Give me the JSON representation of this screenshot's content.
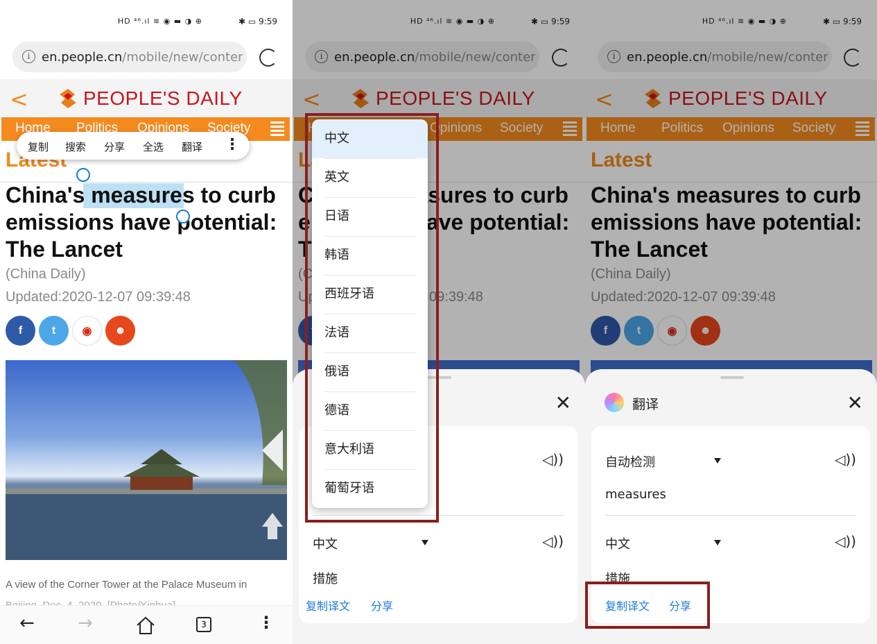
{
  "status": {
    "icons": "HD ⁴⁶.ıl ≋ ◉ ▬ ◑ ⊕",
    "right": "✱ ▭ 9:59"
  },
  "browser": {
    "url_domain": "en.people.cn",
    "url_path": "/mobile/new/content.",
    "tab_count": "3"
  },
  "site": {
    "brand": "PEOPLE'S DAILY",
    "nav": [
      "Home",
      "Politics",
      "Opinions",
      "Society"
    ],
    "section": "Latest",
    "headline_pre": "China's ",
    "headline_sel": "measures",
    "headline_post": " to curb emissions have potential: The Lancet",
    "headline_full": "China's measures to curb emissions have potential: The Lancet",
    "source": "(China Daily)",
    "updated": "Updated:2020-12-07 09:39:48",
    "caption": "A view of the Corner Tower at the Palace Museum in",
    "caption2": "Beijing, Dec. 4, 2020. [Photo/Xinhua]"
  },
  "context_menu": [
    "复制",
    "搜索",
    "分享",
    "全选",
    "翻译"
  ],
  "translate": {
    "title": "翻译",
    "source_lang": "自动检测",
    "source_text": "measures",
    "target_lang": "中文",
    "target_text": "措施",
    "copy_label": "复制译文",
    "share_label": "分享"
  },
  "languages": [
    "中文",
    "英文",
    "日语",
    "韩语",
    "西班牙语",
    "法语",
    "俄语",
    "德语",
    "意大利语",
    "葡萄牙语"
  ],
  "colors": {
    "orange": "#f58b1f",
    "brand_red": "#c8161e",
    "link_blue": "#1a7ad9",
    "highlight_box": "#8b1e1e"
  }
}
